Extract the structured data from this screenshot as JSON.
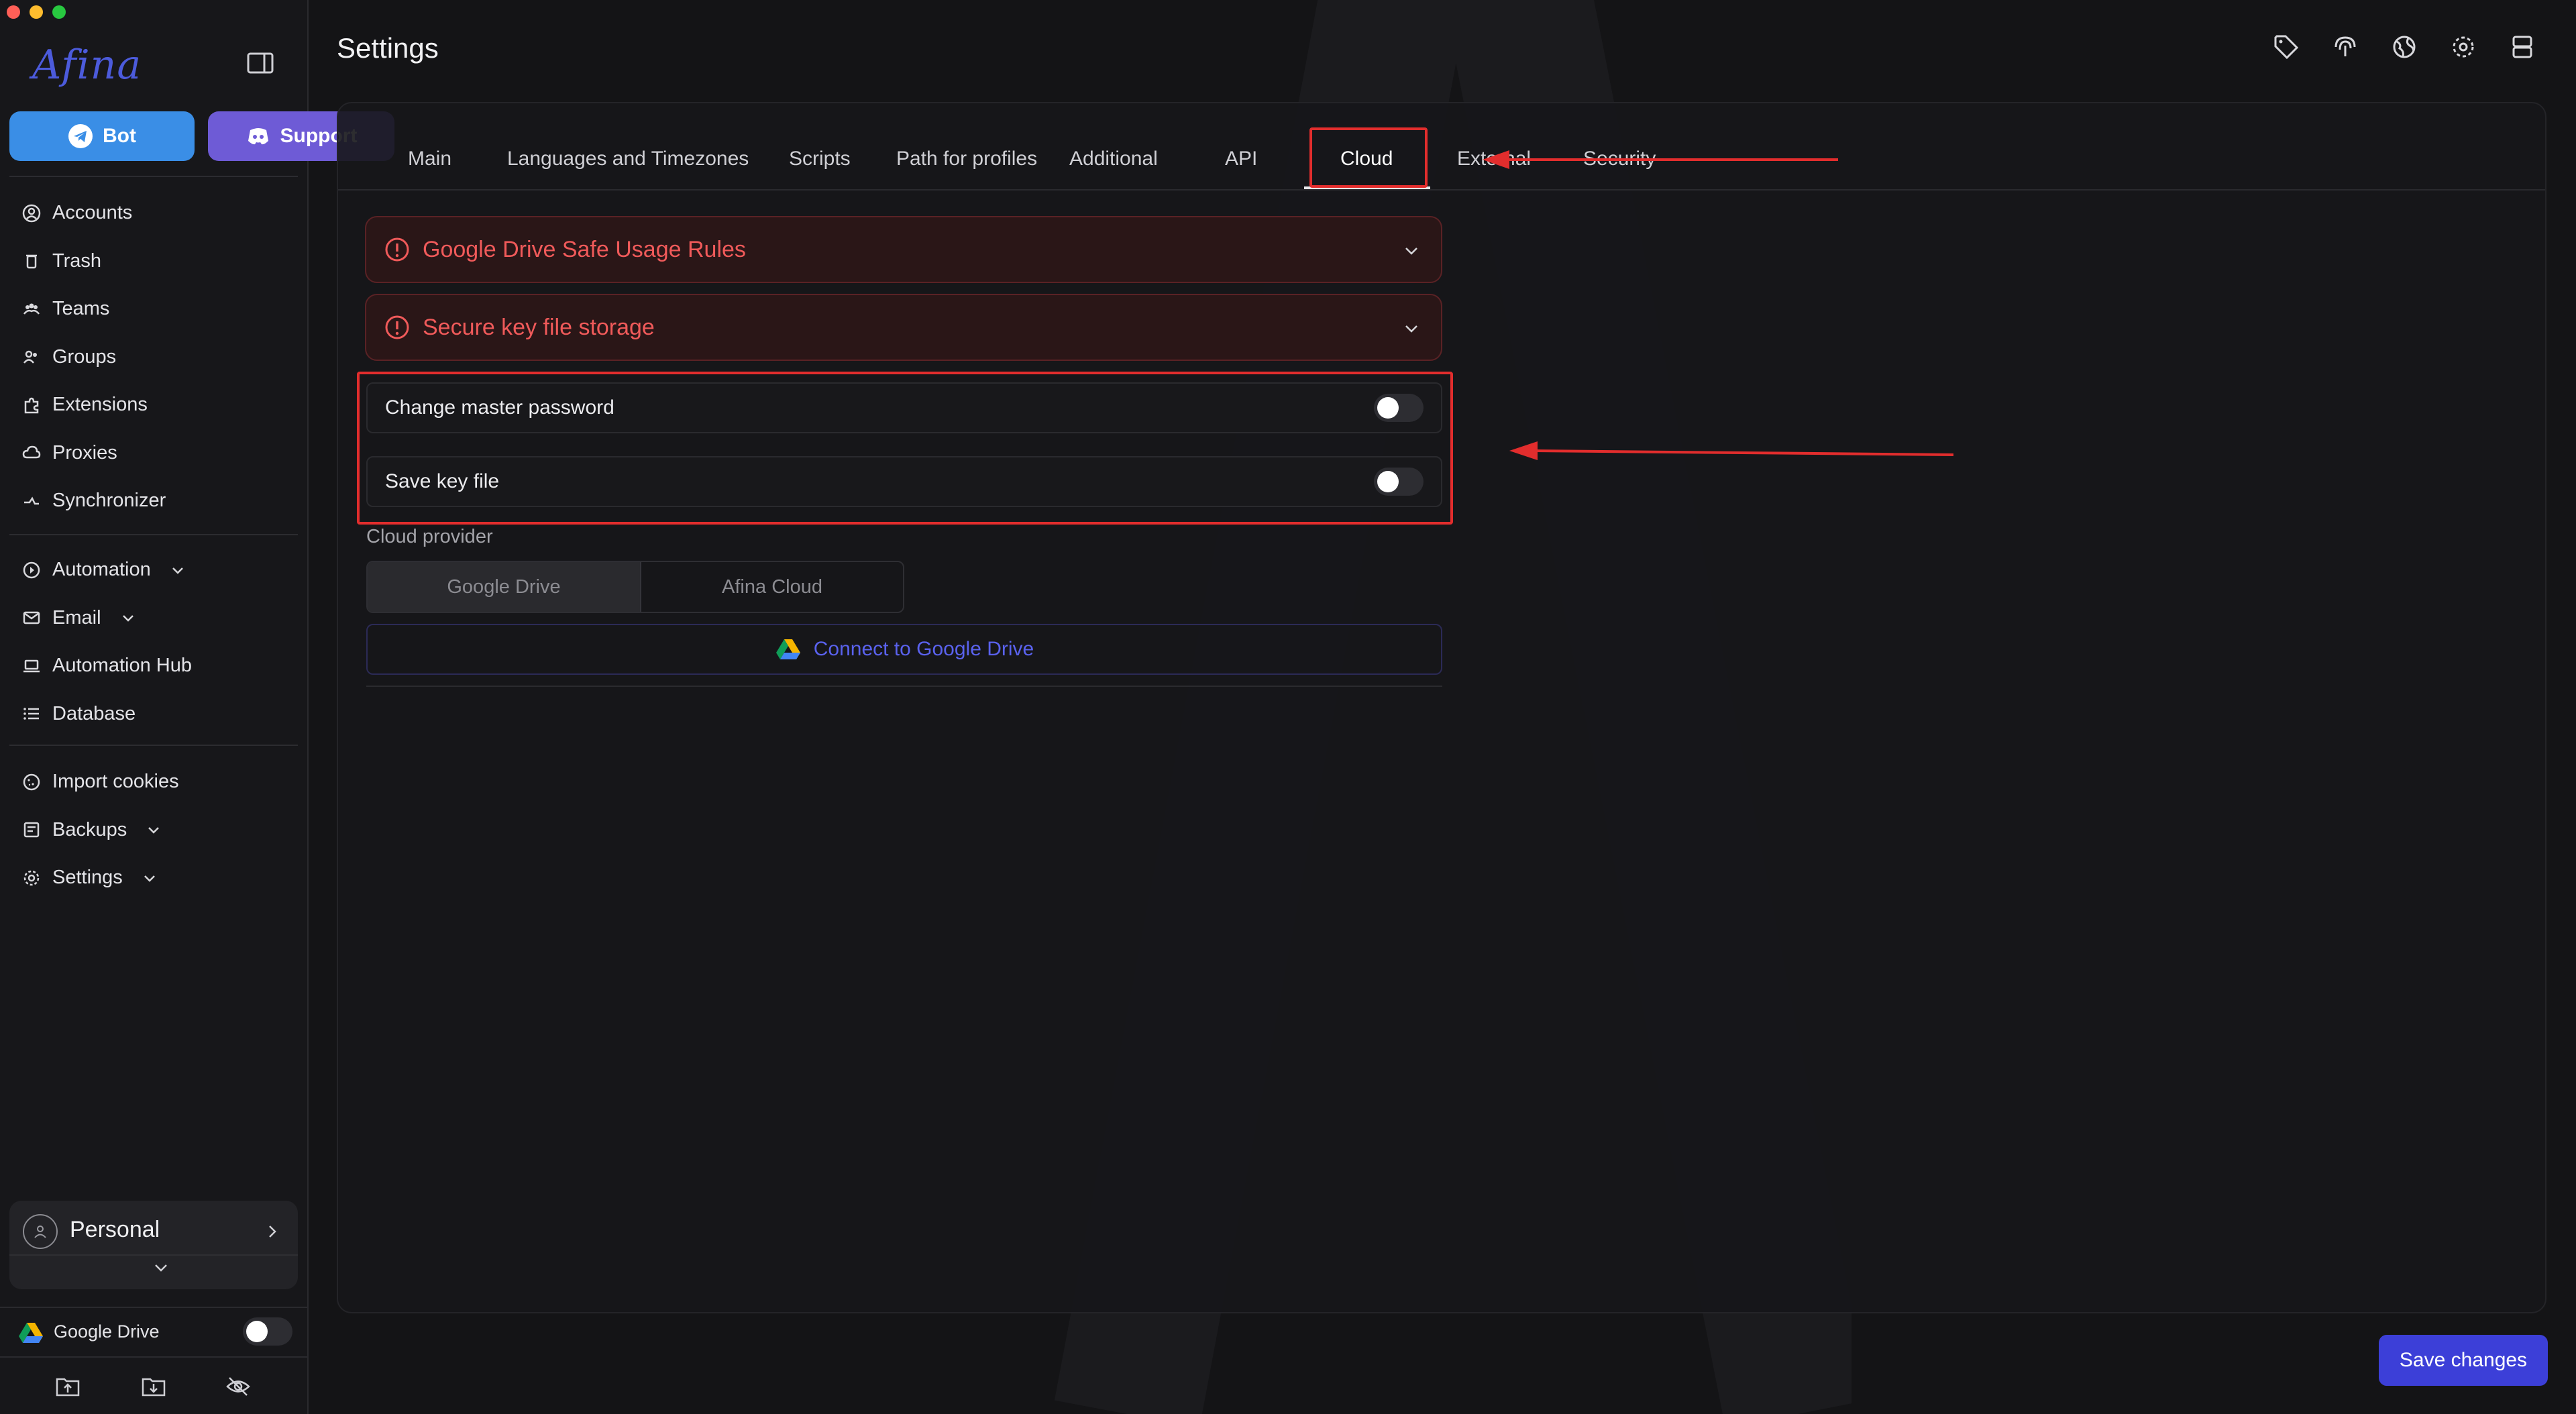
{
  "sidebar": {
    "logo": "Afina",
    "bot_label": "Bot",
    "support_label": "Support",
    "nav_main": [
      {
        "label": "Accounts",
        "icon": "user-circle-icon"
      },
      {
        "label": "Trash",
        "icon": "trash-icon"
      },
      {
        "label": "Teams",
        "icon": "team-icon"
      },
      {
        "label": "Groups",
        "icon": "group-icon"
      },
      {
        "label": "Extensions",
        "icon": "puzzle-icon"
      },
      {
        "label": "Proxies",
        "icon": "cloud-icon"
      },
      {
        "label": "Synchronizer",
        "icon": "sync-icon"
      }
    ],
    "nav_tools": [
      {
        "label": "Automation",
        "icon": "automation-icon",
        "expandable": true
      },
      {
        "label": "Email",
        "icon": "mail-icon",
        "expandable": true
      },
      {
        "label": "Automation Hub",
        "icon": "laptop-icon"
      },
      {
        "label": "Database",
        "icon": "list-icon"
      }
    ],
    "nav_misc": [
      {
        "label": "Import cookies",
        "icon": "cookie-icon"
      },
      {
        "label": "Backups",
        "icon": "backup-icon",
        "expandable": true
      },
      {
        "label": "Settings",
        "icon": "gear-icon",
        "expandable": true
      }
    ],
    "workspace": "Personal",
    "google_drive_label": "Google Drive",
    "google_drive_enabled": false
  },
  "header": {
    "title": "Settings"
  },
  "tabs": [
    {
      "label": "Main"
    },
    {
      "label": "Languages and Timezones"
    },
    {
      "label": "Scripts"
    },
    {
      "label": "Path for profiles"
    },
    {
      "label": "Additional"
    },
    {
      "label": "API"
    },
    {
      "label": "Cloud",
      "active": true
    },
    {
      "label": "External"
    },
    {
      "label": "Security"
    }
  ],
  "cloud": {
    "accordions": [
      {
        "label": "Google Drive Safe Usage Rules"
      },
      {
        "label": "Secure key file storage"
      }
    ],
    "settings": [
      {
        "label": "Change master password",
        "enabled": false
      },
      {
        "label": "Save key file",
        "enabled": false
      }
    ],
    "provider_label": "Cloud provider",
    "providers": [
      "Google Drive",
      "Afina Cloud"
    ],
    "selected_provider": "Google Drive",
    "connect_label": "Connect to Google Drive"
  },
  "footer": {
    "save_label": "Save changes"
  },
  "colors": {
    "accent": "#3c3fd8",
    "danger": "#f05a5a",
    "annotation": "#e22d2d",
    "bot": "#3a8ee6",
    "support": "#6e5bd6"
  }
}
